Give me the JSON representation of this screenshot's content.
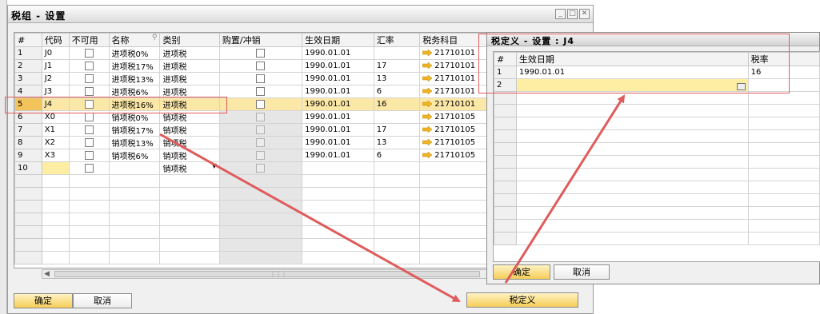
{
  "main": {
    "title": "税组 - 设置",
    "columns": [
      "#",
      "代码",
      "不可用",
      "名称",
      "类别",
      "购置/冲销",
      "生效日期",
      "汇率",
      "税务科目"
    ],
    "rows": [
      {
        "n": "1",
        "code": "J0",
        "name": "进项税0%",
        "cat": "进项税",
        "date": "1990.01.01",
        "rate": "",
        "acct": "21710101"
      },
      {
        "n": "2",
        "code": "J1",
        "name": "进项税17%",
        "cat": "进项税",
        "date": "1990.01.01",
        "rate": "17",
        "acct": "21710101"
      },
      {
        "n": "3",
        "code": "J2",
        "name": "进项税13%",
        "cat": "进项税",
        "date": "1990.01.01",
        "rate": "13",
        "acct": "21710101"
      },
      {
        "n": "4",
        "code": "J3",
        "name": "进项税6%",
        "cat": "进项税",
        "date": "1990.01.01",
        "rate": "6",
        "acct": "21710101"
      },
      {
        "n": "5",
        "code": "J4",
        "name": "进项税16%",
        "cat": "进项税",
        "date": "1990.01.01",
        "rate": "16",
        "acct": "21710101"
      },
      {
        "n": "6",
        "code": "X0",
        "name": "销项税0%",
        "cat": "销项税",
        "date": "1990.01.01",
        "rate": "",
        "acct": "21710105"
      },
      {
        "n": "7",
        "code": "X1",
        "name": "销项税17%",
        "cat": "销项税",
        "date": "1990.01.01",
        "rate": "17",
        "acct": "21710105"
      },
      {
        "n": "8",
        "code": "X2",
        "name": "销项税13%",
        "cat": "销项税",
        "date": "1990.01.01",
        "rate": "13",
        "acct": "21710105"
      },
      {
        "n": "9",
        "code": "X3",
        "name": "销项税6%",
        "cat": "销项税",
        "date": "1990.01.01",
        "rate": "6",
        "acct": "21710105"
      },
      {
        "n": "10",
        "code": "",
        "name": "",
        "cat": "销项税",
        "date": "",
        "rate": "",
        "acct": ""
      }
    ],
    "selected_row": 5,
    "ok_label": "确定",
    "cancel_label": "取消",
    "tax_def_label": "税定义"
  },
  "sub": {
    "title": "税定义 - 设置 : J4",
    "columns": [
      "#",
      "生效日期",
      "税率"
    ],
    "rows": [
      {
        "n": "1",
        "date": "1990.01.01",
        "rate": "16"
      },
      {
        "n": "2",
        "date": "",
        "rate": ""
      }
    ],
    "ok_label": "确定",
    "cancel_label": "取消"
  },
  "colors": {
    "selected_row": "#fbe7a6",
    "button_gold": "#f6cd57",
    "annotation_red": "#e05b5b"
  }
}
